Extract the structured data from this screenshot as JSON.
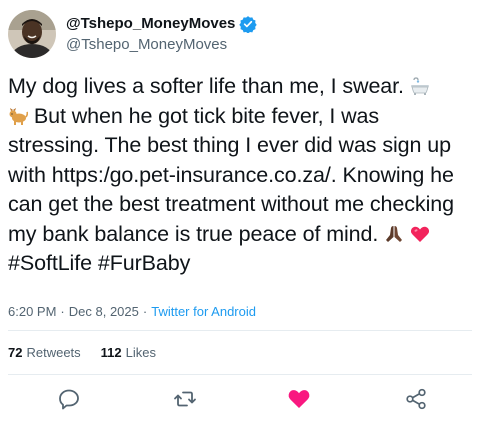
{
  "user": {
    "display_name": "@Tshepo_MoneyMoves",
    "handle": "@Tshepo_MoneyMoves",
    "verified": true
  },
  "tweet": {
    "line1": "My dog lives a softer life than me, I swear. ",
    "line2": " But when he got tick bite fever, I was stressing. The best thing I ever did was sign up with https:/go.pet-insurance.co.za/. Knowing he can get the best treatment without me checking my bank balance is true peace of mind. ",
    "hashtags": "#SoftLife #FurBaby",
    "emojis": [
      "bathtub",
      "dog",
      "praying-hands",
      "heart"
    ]
  },
  "meta": {
    "time": "6:20 PM",
    "separator": "·",
    "date": "Dec 8, 2025",
    "separator2": "·",
    "source": "Twitter for Android"
  },
  "stats": {
    "retweets_count": "72",
    "retweets_label": "Retweets",
    "likes_count": "112",
    "likes_label": "Likes"
  },
  "colors": {
    "accent": "#1d9bf0",
    "like": "#f91880",
    "icon_gray": "#536471"
  },
  "actions": {
    "reply_icon": "reply-icon",
    "retweet_icon": "retweet-icon",
    "like_icon": "heart-icon",
    "share_icon": "share-icon"
  }
}
